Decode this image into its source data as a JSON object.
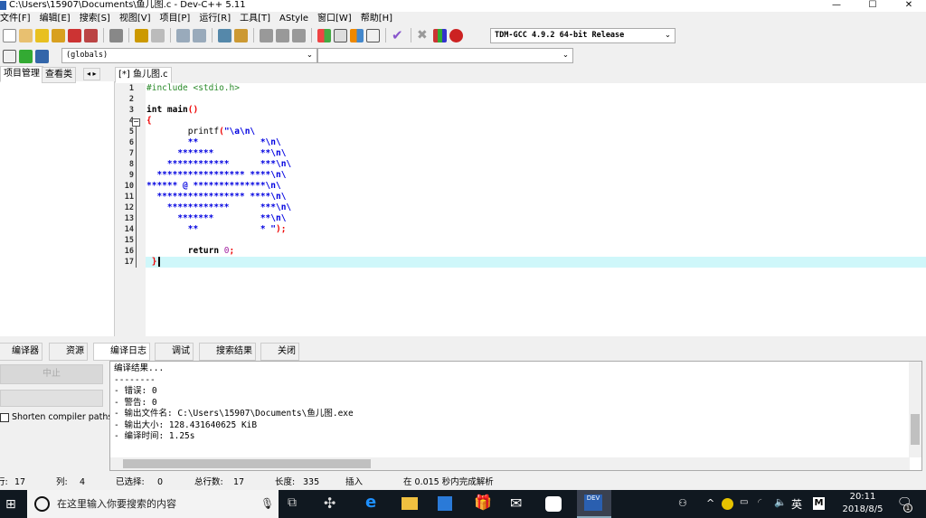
{
  "window": {
    "title": "C:\\Users\\15907\\Documents\\鱼儿图.c - Dev-C++ 5.11",
    "min": "—",
    "max": "☐",
    "close": "✕"
  },
  "menu": [
    "文件[F]",
    "编辑[E]",
    "搜索[S]",
    "视图[V]",
    "项目[P]",
    "运行[R]",
    "工具[T]",
    "AStyle",
    "窗口[W]",
    "帮助[H]"
  ],
  "toolbar": {
    "compiler_select": "TDM-GCC 4.9.2 64-bit Release",
    "scope_select": "(globals)",
    "symbol_select": ""
  },
  "left_panel": {
    "tabs": [
      "项目管理",
      "查看类"
    ]
  },
  "editor": {
    "tab": "[*] 鱼儿图.c",
    "line_numbers": [
      "1",
      "2",
      "3",
      "4",
      "5",
      "6",
      "7",
      "8",
      "9",
      "10",
      "11",
      "12",
      "13",
      "14",
      "15",
      "16",
      "17"
    ],
    "lines": {
      "l1": "#include <stdio.h>",
      "l3a": "int",
      "l3b": " main",
      "l3c": "()",
      "l4": "{",
      "l5a": "        printf",
      "l5b": "(",
      "l5c": "\"\\a\\n\\",
      "l6": "        **            *\\n\\",
      "l7": "      *******         **\\n\\",
      "l8": "    ************      ***\\n\\",
      "l9": "  ***************** ****\\n\\",
      "l10": "****** @ **************\\n\\",
      "l11": "  ***************** ****\\n\\",
      "l12": "    ************      ***\\n\\",
      "l13": "      *******         **\\n\\",
      "l14a": "        **            * \"",
      "l14b": ");",
      "l16a": "        return ",
      "l16b": "0",
      "l16c": ";",
      "l17": " }"
    }
  },
  "bottom_tabs": [
    "编译器",
    "资源",
    "编译日志",
    "调试",
    "搜索结果",
    "关闭"
  ],
  "compile_panel": {
    "stop_button": "中止",
    "shorten_paths": "Shorten compiler paths",
    "shorten_checked": false,
    "log": [
      "编译结果...",
      "--------",
      "- 错误: 0",
      "- 警告: 0",
      "- 输出文件名: C:\\Users\\15907\\Documents\\鱼儿图.exe",
      "- 输出大小: 128.431640625 KiB",
      "- 编译时间: 1.25s"
    ]
  },
  "status": {
    "row_label": "行:",
    "row": "17",
    "col_label": "列:",
    "col": "4",
    "sel_label": "已选择:",
    "sel": "0",
    "total_label": "总行数:",
    "total": "17",
    "len_label": "长度:",
    "len": "335",
    "mode": "插入",
    "parse": "在 0.015 秒内完成解析"
  },
  "taskbar": {
    "search_placeholder": "在这里输入你要搜索的内容",
    "time": "20:11",
    "date": "2018/8/5",
    "ime": "英",
    "notifications": "1"
  }
}
